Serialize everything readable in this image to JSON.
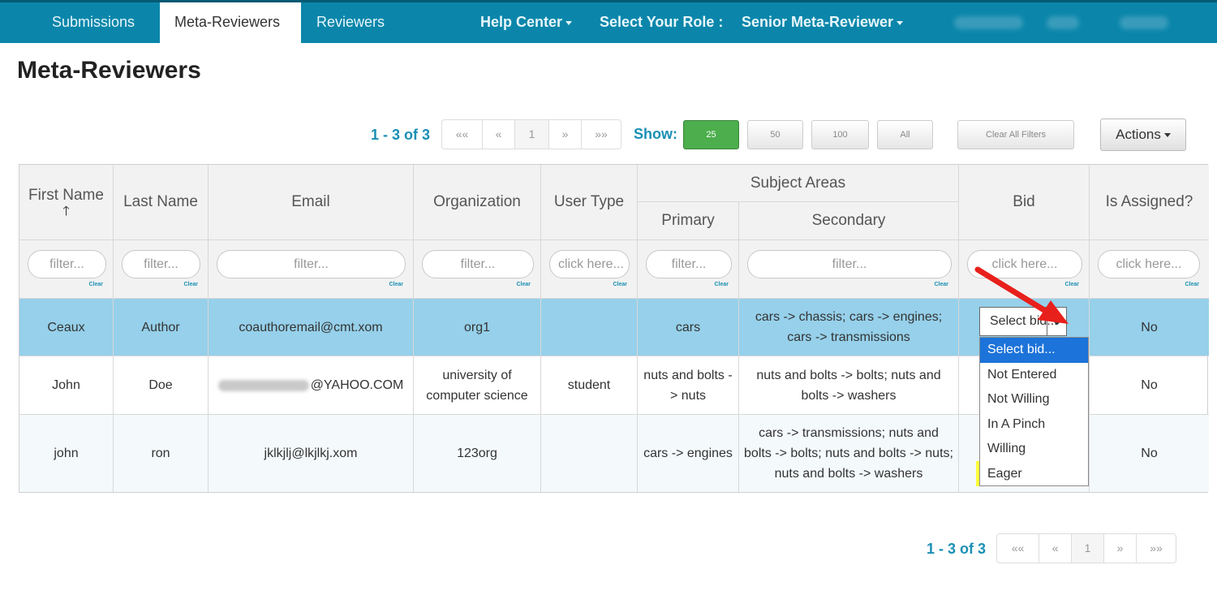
{
  "nav": {
    "tabs": [
      {
        "label": "Submissions"
      },
      {
        "label": "Meta-Reviewers"
      },
      {
        "label": "Reviewers"
      }
    ],
    "help_center": "Help Center",
    "role_label": "Select Your Role :",
    "role_value": "Senior Meta-Reviewer"
  },
  "page": {
    "title": "Meta-Reviewers"
  },
  "pager": {
    "count": "1 - 3 of 3",
    "first": "««",
    "prev": "«",
    "current": "1",
    "next": "»",
    "last": "»»"
  },
  "show": {
    "label": "Show:",
    "options": [
      "25",
      "50",
      "100",
      "All"
    ],
    "selected": "25"
  },
  "clear_filters": "Clear All Filters",
  "actions": "Actions",
  "table": {
    "headers": {
      "first_name": "First Name",
      "last_name": "Last Name",
      "email": "Email",
      "organization": "Organization",
      "user_type": "User Type",
      "subject_areas": "Subject Areas",
      "primary": "Primary",
      "secondary": "Secondary",
      "bid": "Bid",
      "is_assigned": "Is Assigned?"
    },
    "sort_icon": "arrow-up-icon",
    "filters": [
      "filter...",
      "filter...",
      "filter...",
      "filter...",
      "click here...",
      "filter...",
      "filter...",
      "click here...",
      "click here..."
    ],
    "clear_label": "Clear",
    "rows": [
      {
        "first": "Ceaux",
        "last": "Author",
        "email": "coauthoremail@cmt.xom",
        "org": "org1",
        "user_type": "",
        "primary": "cars",
        "secondary": "cars -> chassis; cars -> engines; cars -> transmissions",
        "bid": "Select bid...",
        "assigned": "No"
      },
      {
        "first": "John",
        "last": "Doe",
        "email": "@YAHOO.COM",
        "org": "university of computer science",
        "user_type": "student",
        "primary": "nuts and bolts -> nuts",
        "secondary": "nuts and bolts -> bolts; nuts and bolts -> washers",
        "bid": "",
        "assigned": "No"
      },
      {
        "first": "john",
        "last": "ron",
        "email": "jklkjlj@lkjlkj.xom",
        "org": "123org",
        "user_type": "",
        "primary": "cars -> engines",
        "secondary": "cars -> transmissions; nuts and bolts -> bolts; nuts and bolts -> nuts; nuts and bolts -> washers",
        "bid": "",
        "assigned": "No"
      }
    ]
  },
  "bid_dropdown": {
    "options": [
      "Select bid...",
      "Not Entered",
      "Not Willing",
      "In A Pinch",
      "Willing",
      "Eager"
    ],
    "highlighted": "Select bid...",
    "emphasized": "Eager"
  },
  "colors": {
    "nav_bg": "#0b86aa",
    "accent": "#1a8fb4",
    "selected_row": "#96d0ea",
    "show_active": "#4cae4c",
    "annotation_arrow": "#e8201c",
    "annotation_highlight": "#ffff3c"
  }
}
